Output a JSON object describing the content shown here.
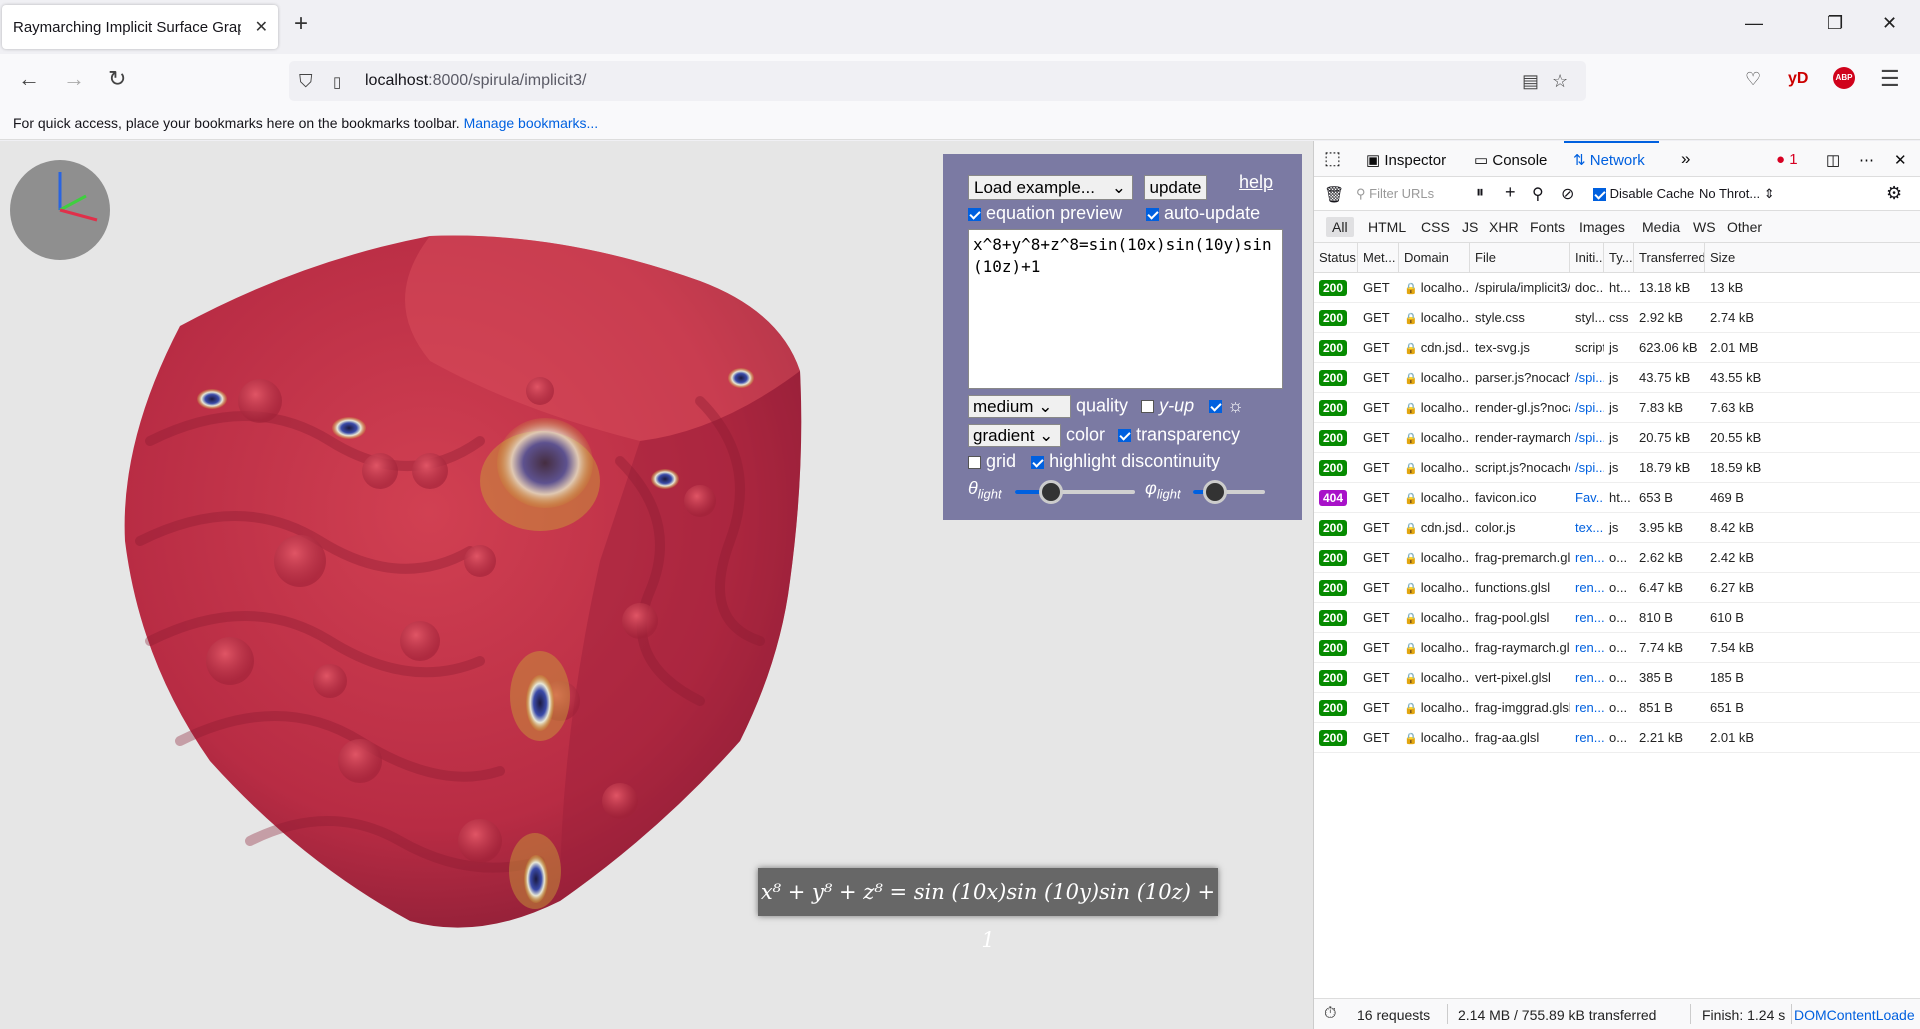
{
  "browser": {
    "tab_title": "Raymarching Implicit Surface Graph",
    "url_host": "localhost",
    "url_rest": ":8000/spirula/implicit3/",
    "bookmarks_hint": "For quick access, place your bookmarks here on the bookmarks toolbar.",
    "bookmarks_link": "Manage bookmarks...",
    "ext_yd": "yD",
    "ext_abp": "ABP"
  },
  "panel": {
    "example_select": "Load example...",
    "update_label": "update",
    "help_label": "help",
    "equation_preview_label": "equation preview",
    "auto_update_label": "auto-update",
    "equation_text": "x^8+y^8+z^8=sin(10x)sin(10y)sin(10z)+1",
    "quality_select": "medium",
    "quality_label": "quality",
    "yup_label": "y-up",
    "color_select": "gradient",
    "color_label": "color",
    "transparency_label": "transparency",
    "grid_label": "grid",
    "highlight_label": "highlight discontinuity",
    "theta_label": "θ",
    "phi_label": "φ",
    "light_sub": "light",
    "theta_value": 0.3,
    "phi_value": 0.3,
    "equation_preview_checked": true,
    "auto_update_checked": true,
    "yup_checked": false,
    "sun_checked": true,
    "transparency_checked": true,
    "grid_checked": false,
    "highlight_checked": true
  },
  "equation_render": "x⁸ + y⁸ + z⁸ = sin (10x)sin (10y)sin (10z) + 1",
  "devtools": {
    "tabs": [
      "Inspector",
      "Console",
      "Network"
    ],
    "active_tab": "Network",
    "error_count": "1",
    "filter_placeholder": "Filter URLs",
    "disable_cache_label": "Disable Cache",
    "throttle_label": "No Throt...",
    "type_filters": [
      "All",
      "HTML",
      "CSS",
      "JS",
      "XHR",
      "Fonts",
      "Images",
      "Media",
      "WS",
      "Other"
    ],
    "columns": [
      "Status",
      "Met...",
      "Domain",
      "File",
      "Initi...",
      "Ty...",
      "Transferred",
      "Size"
    ],
    "rows": [
      {
        "status": "200",
        "method": "GET",
        "domain": "localho...",
        "file": "/spirula/implicit3/",
        "initiator": "doc...",
        "type": "ht...",
        "transferred": "13.18 kB",
        "size": "13 kB"
      },
      {
        "status": "200",
        "method": "GET",
        "domain": "localho...",
        "file": "style.css",
        "initiator": "styl...",
        "type": "css",
        "transferred": "2.92 kB",
        "size": "2.74 kB"
      },
      {
        "status": "200",
        "method": "GET",
        "domain": "cdn.jsd...",
        "file": "tex-svg.js",
        "initiator": "script",
        "type": "js",
        "transferred": "623.06 kB",
        "size": "2.01 MB"
      },
      {
        "status": "200",
        "method": "GET",
        "domain": "localho...",
        "file": "parser.js?nocache=",
        "initiator": "/spi...",
        "type": "js",
        "transferred": "43.75 kB",
        "size": "43.55 kB"
      },
      {
        "status": "200",
        "method": "GET",
        "domain": "localho...",
        "file": "render-gl.js?nocacl",
        "initiator": "/spi...",
        "type": "js",
        "transferred": "7.83 kB",
        "size": "7.63 kB"
      },
      {
        "status": "200",
        "method": "GET",
        "domain": "localho...",
        "file": "render-raymarch.js",
        "initiator": "/spi...",
        "type": "js",
        "transferred": "20.75 kB",
        "size": "20.55 kB"
      },
      {
        "status": "200",
        "method": "GET",
        "domain": "localho...",
        "file": "script.js?nocache=",
        "initiator": "/spi...",
        "type": "js",
        "transferred": "18.79 kB",
        "size": "18.59 kB"
      },
      {
        "status": "404",
        "method": "GET",
        "domain": "localho...",
        "file": "favicon.ico",
        "initiator": "Fav...",
        "type": "ht...",
        "transferred": "653 B",
        "size": "469 B"
      },
      {
        "status": "200",
        "method": "GET",
        "domain": "cdn.jsd...",
        "file": "color.js",
        "initiator": "tex...",
        "type": "js",
        "transferred": "3.95 kB",
        "size": "8.42 kB"
      },
      {
        "status": "200",
        "method": "GET",
        "domain": "localho...",
        "file": "frag-premarch.glsl",
        "initiator": "ren...",
        "type": "o...",
        "transferred": "2.62 kB",
        "size": "2.42 kB"
      },
      {
        "status": "200",
        "method": "GET",
        "domain": "localho...",
        "file": "functions.glsl",
        "initiator": "ren...",
        "type": "o...",
        "transferred": "6.47 kB",
        "size": "6.27 kB"
      },
      {
        "status": "200",
        "method": "GET",
        "domain": "localho...",
        "file": "frag-pool.glsl",
        "initiator": "ren...",
        "type": "o...",
        "transferred": "810 B",
        "size": "610 B"
      },
      {
        "status": "200",
        "method": "GET",
        "domain": "localho...",
        "file": "frag-raymarch.glsl",
        "initiator": "ren...",
        "type": "o...",
        "transferred": "7.74 kB",
        "size": "7.54 kB"
      },
      {
        "status": "200",
        "method": "GET",
        "domain": "localho...",
        "file": "vert-pixel.glsl",
        "initiator": "ren...",
        "type": "o...",
        "transferred": "385 B",
        "size": "185 B"
      },
      {
        "status": "200",
        "method": "GET",
        "domain": "localho...",
        "file": "frag-imggrad.glsl",
        "initiator": "ren...",
        "type": "o...",
        "transferred": "851 B",
        "size": "651 B"
      },
      {
        "status": "200",
        "method": "GET",
        "domain": "localho...",
        "file": "frag-aa.glsl",
        "initiator": "ren...",
        "type": "o...",
        "transferred": "2.21 kB",
        "size": "2.01 kB"
      }
    ],
    "footer": {
      "requests": "16 requests",
      "transferred": "2.14 MB / 755.89 kB transferred",
      "finish": "Finish: 1.24 s",
      "dom": "DOMContentLoade"
    }
  },
  "colors": {
    "panel_bg": "#7b7aa3",
    "accent": "#0060df",
    "status_ok": "#058b00",
    "status_404": "#a811c9",
    "surface": "#c8324a"
  }
}
